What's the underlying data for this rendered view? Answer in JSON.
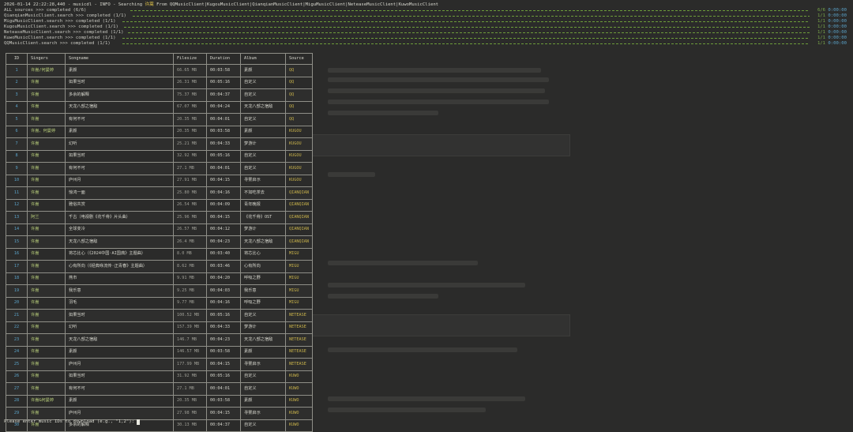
{
  "header": {
    "prefix": "2026-01-14 22:22:28,440 - musicdl - INFO - Searching ",
    "query": "许嵩",
    "suffix": " From QQMusicClient|KugouMusicClient|QianqianMusicClient|MiguMusicClient|NeteaseMusicClient|KuwoMusicClient"
  },
  "progress_rows": [
    {
      "label": "ALL sources >>> completed (6/6)",
      "count": "6/6",
      "time": "0:00:00"
    },
    {
      "label": "QianqianMusicClient.search >>> completed (1/1)",
      "count": "1/1",
      "time": "0:00:00"
    },
    {
      "label": "MiguMusicClient.search >>> completed (1/1)",
      "count": "1/1",
      "time": "0:00:00"
    },
    {
      "label": "KugouMusicClient.search >>> completed (1/1)",
      "count": "1/1",
      "time": "0:00:00"
    },
    {
      "label": "NeteaseMusicClient.search >>> completed (1/1)",
      "count": "1/1",
      "time": "0:00:00"
    },
    {
      "label": "KuwoMusicClient.search >>> completed (1/1)",
      "count": "1/1",
      "time": "0:00:00"
    },
    {
      "label": "QQMusicClient.search >>> completed (1/1)",
      "count": "1/1",
      "time": "0:00:00"
    }
  ],
  "table": {
    "headers": [
      "ID",
      "Singers",
      "Songname",
      "Filesize",
      "Duration",
      "Album",
      "Source"
    ],
    "rows": [
      [
        "1",
        "许嵩/何曼婷",
        "素颜",
        "66.65 MB",
        "00:03:58",
        "素颜",
        "QQ"
      ],
      [
        "2",
        "许嵩",
        "如果当时",
        "26.31 MB",
        "00:05:16",
        "自定义",
        "QQ"
      ],
      [
        "3",
        "许嵩",
        "多余的解释",
        "75.37 MB",
        "00:04:37",
        "自定义",
        "QQ"
      ],
      [
        "4",
        "许嵩",
        "天龙八部之宿敌",
        "67.07 MB",
        "00:04:24",
        "天龙八部之宿敌",
        "QQ"
      ],
      [
        "5",
        "许嵩",
        "有何不可",
        "20.35 MB",
        "00:04:01",
        "自定义",
        "QQ"
      ],
      [
        "6",
        "许嵩、何曼婷",
        "素颜",
        "20.35 MB",
        "00:03:58",
        "素颜",
        "KUGOU"
      ],
      [
        "7",
        "许嵩",
        "幻听",
        "25.21 MB",
        "00:04:33",
        "梦游计",
        "KUGOU"
      ],
      [
        "8",
        "许嵩",
        "如果当时",
        "32.92 MB",
        "00:05:16",
        "自定义",
        "KUGOU"
      ],
      [
        "9",
        "许嵩",
        "有何不可",
        "27.1 MB",
        "00:04:01",
        "自定义",
        "KUGOU"
      ],
      [
        "10",
        "许嵩",
        "庐州月",
        "27.91 MB",
        "00:04:15",
        "寻雾启示",
        "KUGOU"
      ],
      [
        "11",
        "许嵩",
        "惊鸿一面",
        "25.80 MB",
        "00:04:16",
        "不如吃茶去",
        "QIANQIAN"
      ],
      [
        "12",
        "许嵩",
        "雅俗共赏",
        "26.54 MB",
        "00:04:09",
        "青年晚报",
        "QIANQIAN"
      ],
      [
        "13",
        "阿兰",
        "千古（电视剧《花千骨》片头曲）",
        "25.96 MB",
        "00:04:15",
        "《花千骨》OST",
        "QIANQIAN"
      ],
      [
        "14",
        "许嵩",
        "全球变冷",
        "26.57 MB",
        "00:04:12",
        "梦游计",
        "QIANQIAN"
      ],
      [
        "15",
        "许嵩",
        "天龙八部之宿敌",
        "26.4 MB",
        "00:04:23",
        "天龙八部之宿敌",
        "QIANQIAN"
      ],
      [
        "16",
        "许嵩",
        "将芯比心（《2024中国·AI国典》主题曲）",
        "8.0 MB",
        "00:03:40",
        "将芯比心",
        "MIGU"
      ],
      [
        "17",
        "许嵩",
        "心有所向（《经典咏流传·正青春》主题曲）",
        "8.62 MB",
        "00:03:46",
        "心有所向",
        "MIGU"
      ],
      [
        "18",
        "许嵩",
        "燕市",
        "9.91 MB",
        "00:04:20",
        "呼吸之野",
        "MIGU"
      ],
      [
        "19",
        "许嵩",
        "我乐意",
        "9.25 MB",
        "00:04:03",
        "我乐意",
        "MIGU"
      ],
      [
        "20",
        "许嵩",
        "羽毛",
        "9.77 MB",
        "00:04:16",
        "呼吸之野",
        "MIGU"
      ],
      [
        "21",
        "许嵩",
        "如果当时",
        "100.52 MB",
        "00:05:16",
        "自定义",
        "NETEASE"
      ],
      [
        "22",
        "许嵩",
        "幻听",
        "157.39 MB",
        "00:04:33",
        "梦游计",
        "NETEASE"
      ],
      [
        "23",
        "许嵩",
        "天龙八部之宿敌",
        "146.7 MB",
        "00:04:23",
        "天龙八部之宿敌",
        "NETEASE"
      ],
      [
        "24",
        "许嵩",
        "素颜",
        "146.57 MB",
        "00:03:58",
        "素颜",
        "NETEASE"
      ],
      [
        "25",
        "许嵩",
        "庐州月",
        "177.99 MB",
        "00:04:15",
        "寻雾启示",
        "NETEASE"
      ],
      [
        "26",
        "许嵩",
        "如果当时",
        "31.92 MB",
        "00:05:16",
        "自定义",
        "KUWO"
      ],
      [
        "27",
        "许嵩",
        "有何不可",
        "27.1 MB",
        "00:04:01",
        "自定义",
        "KUWO"
      ],
      [
        "28",
        "许嵩&何曼婷",
        "素颜",
        "20.35 MB",
        "00:03:58",
        "素颜",
        "KUWO"
      ],
      [
        "29",
        "许嵩",
        "庐州月",
        "27.98 MB",
        "00:04:15",
        "寻雾启示",
        "KUWO"
      ],
      [
        "30",
        "许嵩",
        "多余的解释",
        "30.13 MB",
        "00:04:37",
        "自定义",
        "KUWO"
      ]
    ]
  },
  "prompt": {
    "text": "Please enter music IDs to download (e.g., \"1,2\"): "
  },
  "colors": {
    "background": "#2b2b2a",
    "progress_bar": "#6d9d3a",
    "highlight": "#e6c84a",
    "id_blue": "#5aa2c8"
  }
}
